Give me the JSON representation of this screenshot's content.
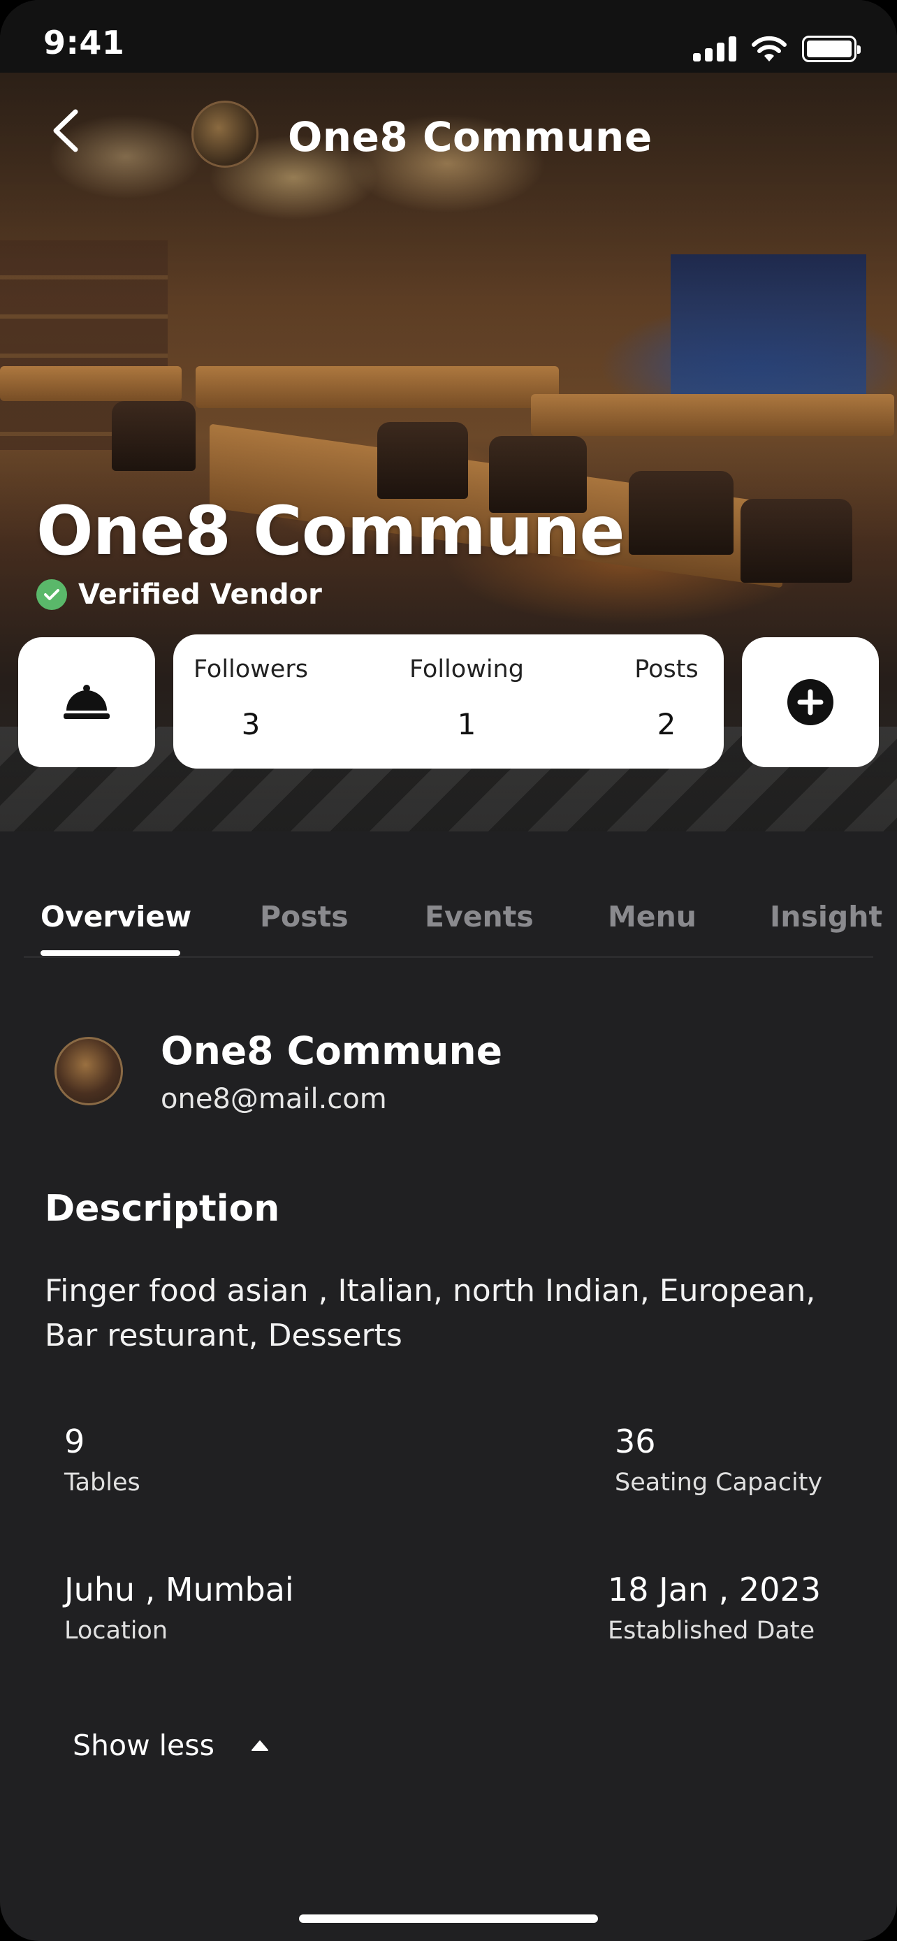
{
  "status_bar": {
    "time": "9:41"
  },
  "header": {
    "title": "One8 Commune"
  },
  "hero": {
    "name": "One8 Commune",
    "verified_label": "Verified Vendor"
  },
  "stats": [
    {
      "label": "Followers",
      "value": "3"
    },
    {
      "label": "Following",
      "value": "1"
    },
    {
      "label": "Posts",
      "value": "2"
    }
  ],
  "tabs": [
    {
      "label": "Overview",
      "active": true
    },
    {
      "label": "Posts",
      "active": false
    },
    {
      "label": "Events",
      "active": false
    },
    {
      "label": "Menu",
      "active": false
    },
    {
      "label": "Insight",
      "active": false
    }
  ],
  "profile": {
    "name": "One8 Commune",
    "email": "one8@mail.com"
  },
  "description": {
    "title": "Description",
    "text": "Finger food asian , Italian, north Indian, European, Bar resturant, Desserts"
  },
  "details": {
    "tables": {
      "value": "9",
      "label": "Tables"
    },
    "seating": {
      "value": "36",
      "label": "Seating Capacity"
    },
    "location": {
      "value": "Juhu , Mumbai",
      "label": "Location"
    },
    "established": {
      "value": "18 Jan , 2023",
      "label": "Established Date"
    }
  },
  "show_less": {
    "label": "Show less"
  },
  "icons": {
    "back": "chevron-left-icon",
    "verified": "check-circle-icon",
    "bell": "service-bell-icon",
    "add": "plus-circle-icon",
    "collapse": "caret-up-icon"
  },
  "colors": {
    "background": "#202022",
    "verified_green": "#5ab86a",
    "tab_inactive": "#8a8a8e",
    "card": "#ffffff"
  }
}
